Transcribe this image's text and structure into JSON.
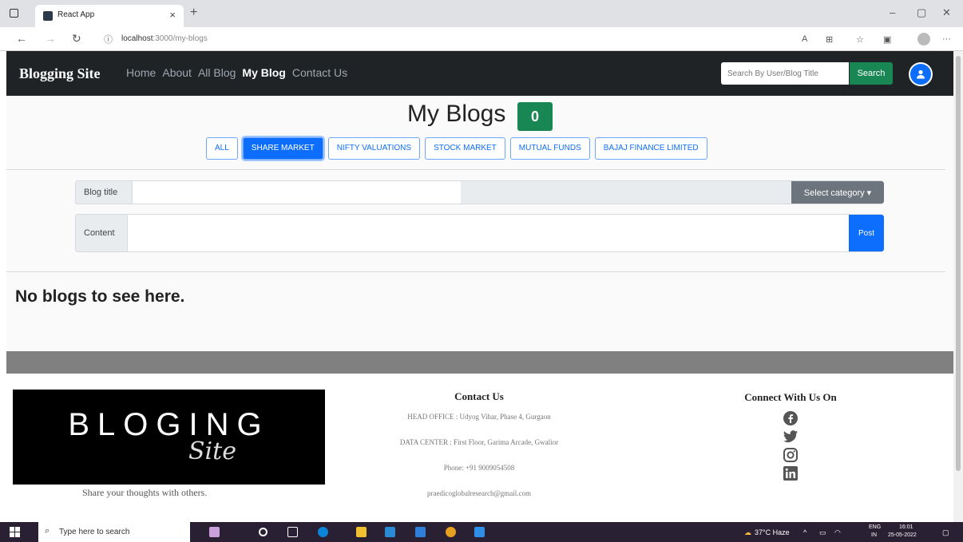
{
  "browser": {
    "tab_title": "React App",
    "tab_close": "×",
    "new_tab": "+",
    "url_host": "localhost",
    "url_path": ":3000/my-blogs",
    "window_controls": [
      "–",
      "▢",
      "✕"
    ]
  },
  "navbar": {
    "brand": "Blogging Site",
    "links": [
      {
        "label": "Home",
        "active": false
      },
      {
        "label": "About",
        "active": false
      },
      {
        "label": "All Blog",
        "active": false
      },
      {
        "label": "My Blog",
        "active": true
      },
      {
        "label": "Contact Us",
        "active": false
      }
    ],
    "search_placeholder": "Search By User/Blog Title",
    "search_button": "Search"
  },
  "page": {
    "title": "My Blogs",
    "count": "0",
    "filters": [
      {
        "label": "ALL",
        "active": false
      },
      {
        "label": "SHARE MARKET",
        "active": true
      },
      {
        "label": "NIFTY VALUATIONS",
        "active": false
      },
      {
        "label": "STOCK MARKET",
        "active": false
      },
      {
        "label": "MUTUAL FUNDS",
        "active": false
      },
      {
        "label": "BAJAJ FINANCE LIMITED",
        "active": false
      }
    ],
    "form": {
      "title_label": "Blog title",
      "select_label": "Select category ▾",
      "content_label": "Content",
      "post_button": "Post"
    },
    "empty_message": "No blogs to see here."
  },
  "footer": {
    "logo_text": "BLOGING",
    "logo_script": "Site",
    "tagline": "Share your thoughts with others.",
    "contact_heading": "Contact Us",
    "contact_lines": [
      "HEAD OFFICE : Udyog Vihar, Phase 4, Gurgaon",
      "DATA CENTER : First Floor, Garima Arcade, Gwalior",
      "Phone: +91 9009054508",
      "praedicoglobalresearch@gmail.com"
    ],
    "connect_heading": "Connect With Us On",
    "social": [
      "facebook-icon",
      "twitter-icon",
      "instagram-icon",
      "linkedin-icon"
    ]
  },
  "taskbar": {
    "search_text": "Type here to search",
    "weather": "37°C Haze",
    "lang": "ENG",
    "region": "IN",
    "time": "16:01",
    "date": "25-05-2022"
  },
  "colors": {
    "navbar_bg": "#1f2326",
    "primary": "#0d6efd",
    "success": "#198754",
    "secondary": "#6c757d",
    "footer_band": "#808080"
  }
}
